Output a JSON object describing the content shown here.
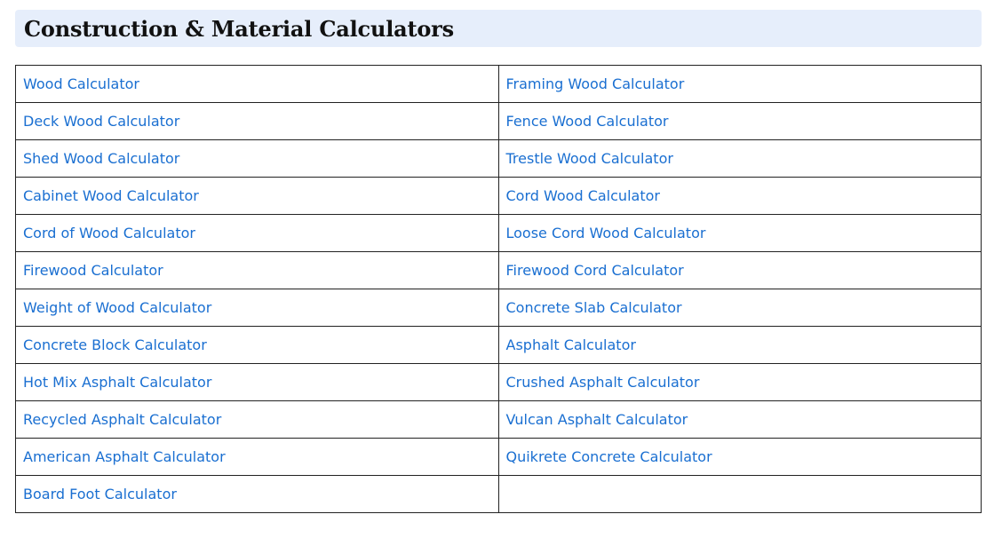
{
  "section": {
    "title": "Construction & Material Calculators"
  },
  "links": {
    "rows": [
      [
        "Wood Calculator",
        "Framing Wood Calculator"
      ],
      [
        "Deck Wood Calculator",
        "Fence Wood Calculator"
      ],
      [
        "Shed Wood Calculator",
        "Trestle Wood Calculator"
      ],
      [
        "Cabinet Wood Calculator",
        "Cord Wood Calculator"
      ],
      [
        "Cord of Wood Calculator",
        "Loose Cord Wood Calculator"
      ],
      [
        "Firewood Calculator",
        "Firewood Cord Calculator"
      ],
      [
        "Weight of Wood Calculator",
        "Concrete Slab Calculator"
      ],
      [
        "Concrete Block Calculator",
        "Asphalt Calculator"
      ],
      [
        "Hot Mix Asphalt Calculator",
        "Crushed Asphalt Calculator"
      ],
      [
        "Recycled Asphalt Calculator",
        "Vulcan Asphalt Calculator"
      ],
      [
        "American Asphalt Calculator",
        "Quikrete Concrete Calculator"
      ],
      [
        "Board Foot Calculator",
        ""
      ]
    ]
  },
  "colors": {
    "link": "#1a6fd1",
    "header_bg": "#e6eefb",
    "border": "#222222"
  }
}
